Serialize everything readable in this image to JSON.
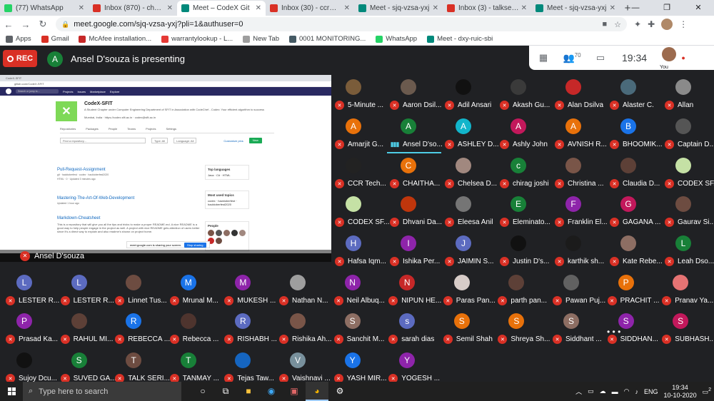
{
  "tabs": [
    {
      "label": "(77) WhatsApp",
      "color": "#25d366"
    },
    {
      "label": "Inbox (870) - chelseadias",
      "color": "#d93025"
    },
    {
      "label": "Meet – CodeX Git",
      "color": "#00897b",
      "active": true
    },
    {
      "label": "Inbox (30) - ccrmediatus",
      "color": "#d93025"
    },
    {
      "label": "Meet - sjq-vzsa-yxj",
      "color": "#00897b"
    },
    {
      "label": "Inbox (3) - talkseriesme",
      "color": "#d93025"
    },
    {
      "label": "Meet - sjq-vzsa-yxj",
      "color": "#00897b"
    }
  ],
  "address": {
    "url": "meet.google.com/sjq-vzsa-yxj?pli=1&authuser=0"
  },
  "bookmarks": [
    {
      "label": "Apps",
      "color": "#5f6368"
    },
    {
      "label": "Gmail",
      "color": "#d93025"
    },
    {
      "label": "McAfee installation...",
      "color": "#c62828"
    },
    {
      "label": "warrantylookup - L...",
      "color": "#e53935"
    },
    {
      "label": "New Tab",
      "color": "#9e9e9e"
    },
    {
      "label": "0001 MONITORING...",
      "color": "#455a64"
    },
    {
      "label": "WhatsApp",
      "color": "#25d366"
    },
    {
      "label": "Meet - dxy-ruic-sbi",
      "color": "#00897b"
    }
  ],
  "meet": {
    "rec_label": "REC",
    "presenter_initial": "A",
    "presenting_text": "Ansel D'souza is presenting",
    "people_count": "70",
    "time": "19:34",
    "you_label": "You",
    "presenter_caption": "Ansel D'souza"
  },
  "presentation": {
    "tab": "CodeX-SFIT",
    "url": "gitlab.com/CodeX-SFIT",
    "search": "Search or jump to...",
    "nav": [
      "Projects",
      "Issues",
      "Marketplace",
      "Explore"
    ],
    "group_name": "CodeX-SFIT",
    "group_desc": "A Student Chapter under Computer Engineering Department of SFIT in Association with CodeChef - Codex: Your efficient algorithm to success",
    "group_meta": "Mumbai, India · https://codex.sfit.ac.in · codex@sfit.ac.in",
    "tabs": [
      "Repositories",
      "Packages",
      "People",
      "Teams",
      "Projects",
      "Settings"
    ],
    "find_placeholder": "Find a repository...",
    "filter_type": "Type: All",
    "filter_lang": "Language: All",
    "customize": "Customize pins",
    "new_btn": "New",
    "repos": [
      {
        "name": "Pull-Request-Assignment",
        "tags": "git · hacktoberfest · codex · hacktoberfest2020",
        "meta": "HTML · 0 · Updated 3 minutes ago"
      },
      {
        "name": "Mastering-The-Art-Of-Web-Development",
        "tags": "",
        "meta": "Updated 1 hour ago"
      },
      {
        "name": "Markdown-Cheatsheet",
        "tags": "",
        "meta": "This is a repository that will give you all the tips and tricks to make a proper README.md. A nice README is a good way to help people engage in the project as well. A project with nice README gets attention of users better since it's a direct way to explain and also readme's shown on project home."
      }
    ],
    "side_lang_title": "Top languages",
    "side_langs": "Java · C# · HTML",
    "side_topics_title": "Most used topics",
    "side_topics": "codex · hacktoberfest · hacktoberfest2020",
    "side_people_title": "People",
    "share_text": "meet.google.com is sharing your screen.",
    "stop_btn": "Stop sharing"
  },
  "participants": [
    {
      "name": "5-Minute ...",
      "initial": "",
      "color": "#7a5c3a"
    },
    {
      "name": "Aaron Dsil...",
      "initial": "",
      "color": "#6b5a4e"
    },
    {
      "name": "Adil Ansari",
      "initial": "",
      "color": "#111111"
    },
    {
      "name": "Akash Gu...",
      "initial": "",
      "color": "#3a3a3a"
    },
    {
      "name": "Alan Dsilva",
      "initial": "",
      "color": "#c62828"
    },
    {
      "name": "Alaster C.",
      "initial": "",
      "color": "#4a6a7a"
    },
    {
      "name": "Allan",
      "initial": "",
      "color": "#8a8a8a"
    },
    {
      "name": "Amarjit G...",
      "initial": "A",
      "color": "#e8710a"
    },
    {
      "name": "Ansel D'so...",
      "initial": "A",
      "color": "#188038",
      "speaking": true
    },
    {
      "name": "ASHLEY D...",
      "initial": "A",
      "color": "#12b5cb"
    },
    {
      "name": "Ashly John",
      "initial": "A",
      "color": "#c2185b"
    },
    {
      "name": "AVNISH R...",
      "initial": "A",
      "color": "#e8710a"
    },
    {
      "name": "BHOOMIK...",
      "initial": "B",
      "color": "#1a73e8"
    },
    {
      "name": "Captain D...",
      "initial": "",
      "color": "#555555"
    },
    {
      "name": "CCR Tech...",
      "initial": "",
      "color": "#222222"
    },
    {
      "name": "CHAITHA...",
      "initial": "C",
      "color": "#e8710a"
    },
    {
      "name": "Chelsea D...",
      "initial": "",
      "color": "#a1887f"
    },
    {
      "name": "chirag joshi",
      "initial": "c",
      "color": "#188038"
    },
    {
      "name": "Christina ...",
      "initial": "",
      "color": "#795548"
    },
    {
      "name": "Claudia D...",
      "initial": "",
      "color": "#5d4037"
    },
    {
      "name": "CODEX SF...",
      "initial": "",
      "color": "#c5e1a5"
    },
    {
      "name": "CODEX SF...",
      "initial": "",
      "color": "#c5e1a5"
    },
    {
      "name": "Dhvani Da...",
      "initial": "",
      "color": "#bf360c"
    },
    {
      "name": "Eleesa Anil",
      "initial": "",
      "color": "#757575"
    },
    {
      "name": "Eleminato...",
      "initial": "E",
      "color": "#188038"
    },
    {
      "name": "Franklin El...",
      "initial": "F",
      "color": "#8e24aa"
    },
    {
      "name": "GAGANA ...",
      "initial": "G",
      "color": "#c2185b"
    },
    {
      "name": "Gaurav Si...",
      "initial": "",
      "color": "#6d4c41"
    },
    {
      "name": "Hafsa Iqm...",
      "initial": "H",
      "color": "#5c6bc0"
    },
    {
      "name": "Ishika Per...",
      "initial": "I",
      "color": "#8e24aa"
    },
    {
      "name": "JAIMIN S...",
      "initial": "J",
      "color": "#5c6bc0"
    },
    {
      "name": "Justin D's...",
      "initial": "",
      "color": "#111111"
    },
    {
      "name": "karthik sh...",
      "initial": "",
      "color": "#1b1b1b"
    },
    {
      "name": "Kate Rebe...",
      "initial": "",
      "color": "#8d6e63"
    },
    {
      "name": "Leah Dso...",
      "initial": "L",
      "color": "#188038"
    },
    {
      "name": "LESTER R...",
      "initial": "L",
      "color": "#5c6bc0"
    },
    {
      "name": "LESTER R...",
      "initial": "L",
      "color": "#5c6bc0"
    },
    {
      "name": "Linnet Tus...",
      "initial": "",
      "color": "#6d4c41"
    },
    {
      "name": "Mrunal M...",
      "initial": "M",
      "color": "#1a73e8"
    },
    {
      "name": "MUKESH ...",
      "initial": "M",
      "color": "#8e24aa"
    },
    {
      "name": "Nathan N...",
      "initial": "",
      "color": "#9e9e9e"
    },
    {
      "name": "Neil Albuq...",
      "initial": "N",
      "color": "#8e24aa"
    },
    {
      "name": "NIPUN HE...",
      "initial": "N",
      "color": "#c62828"
    },
    {
      "name": "Paras Pan...",
      "initial": "",
      "color": "#d7ccc8"
    },
    {
      "name": "parth pan...",
      "initial": "",
      "color": "#5d4037"
    },
    {
      "name": "Pawan Puj...",
      "initial": "",
      "color": "#616161"
    },
    {
      "name": "PRACHIT ...",
      "initial": "P",
      "color": "#e8710a"
    },
    {
      "name": "Pranav Ya...",
      "initial": "",
      "color": "#e57373"
    },
    {
      "name": "Prasad Ka...",
      "initial": "P",
      "color": "#8e24aa"
    },
    {
      "name": "RAHUL MI...",
      "initial": "",
      "color": "#5d4037"
    },
    {
      "name": "REBECCA ...",
      "initial": "R",
      "color": "#1a73e8"
    },
    {
      "name": "Rebecca ...",
      "initial": "",
      "color": "#4e342e"
    },
    {
      "name": "RISHABH ...",
      "initial": "R",
      "color": "#5c6bc0"
    },
    {
      "name": "Rishika Ah...",
      "initial": "",
      "color": "#795548"
    },
    {
      "name": "Sanchit M...",
      "initial": "S",
      "color": "#8d6e63"
    },
    {
      "name": "sarah dias",
      "initial": "s",
      "color": "#5c6bc0"
    },
    {
      "name": "Semil Shah",
      "initial": "S",
      "color": "#e8710a"
    },
    {
      "name": "Shreya Sh...",
      "initial": "S",
      "color": "#e8710a"
    },
    {
      "name": "Siddhant ...",
      "initial": "S",
      "color": "#8d6e63"
    },
    {
      "name": "SIDDHAN...",
      "initial": "S",
      "color": "#8e24aa"
    },
    {
      "name": "SUBHASH...",
      "initial": "S",
      "color": "#c2185b"
    },
    {
      "name": "Sujoy Dcu...",
      "initial": "",
      "color": "#111111"
    },
    {
      "name": "SUVED GA...",
      "initial": "S",
      "color": "#188038"
    },
    {
      "name": "TALK SERI...",
      "initial": "T",
      "color": "#6d4c41"
    },
    {
      "name": "TANMAY ...",
      "initial": "T",
      "color": "#188038"
    },
    {
      "name": "Tejas Taw...",
      "initial": "",
      "color": "#1565c0"
    },
    {
      "name": "Vaishnavi ...",
      "initial": "V",
      "color": "#78909c"
    },
    {
      "name": "YASH MIR...",
      "initial": "Y",
      "color": "#1a73e8"
    },
    {
      "name": "YOGESH ...",
      "initial": "Y",
      "color": "#8e24aa"
    }
  ],
  "more_label": "• • •",
  "taskbar": {
    "search_placeholder": "Type here to search",
    "lang": "ENG",
    "time": "19:34",
    "date": "10-10-2020",
    "notif_count": "2"
  }
}
